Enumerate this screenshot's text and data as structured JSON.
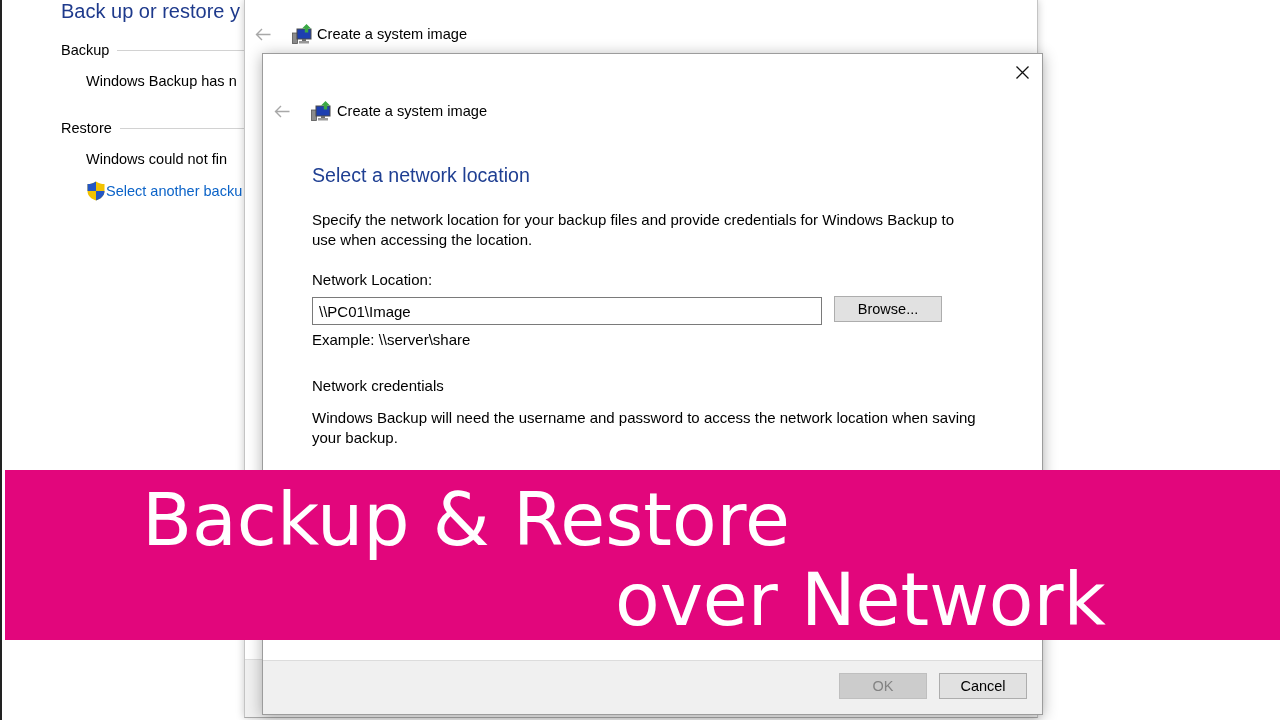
{
  "control_panel": {
    "title": "Back up or restore y",
    "sections": [
      {
        "heading": "Backup",
        "lines": [
          {
            "kind": "text",
            "text": "Windows Backup has n"
          }
        ]
      },
      {
        "heading": "Restore",
        "lines": [
          {
            "kind": "text",
            "text": "Windows could not fin"
          },
          {
            "kind": "link",
            "text": "Select another backu"
          }
        ]
      }
    ]
  },
  "background_dialog": {
    "title": "Create a system image"
  },
  "dialog": {
    "title": "Create a system image",
    "heading": "Select a network location",
    "description": "Specify the network location for your backup files and provide credentials for Windows Backup to use when accessing the location.",
    "location_label": "Network Location:",
    "location_field": {
      "value": "\\\\PC01\\Image"
    },
    "browse_button": "Browse...",
    "example": "Example: \\\\server\\share",
    "credentials_heading": "Network credentials",
    "credentials_description": "Windows Backup will need the username and password to access the network location when saving your backup.",
    "buttons": [
      {
        "label": "OK",
        "disabled": true
      },
      {
        "label": "Cancel",
        "disabled": false
      }
    ]
  },
  "banner": {
    "lines": [
      "Backup & Restore",
      "over Network"
    ]
  }
}
